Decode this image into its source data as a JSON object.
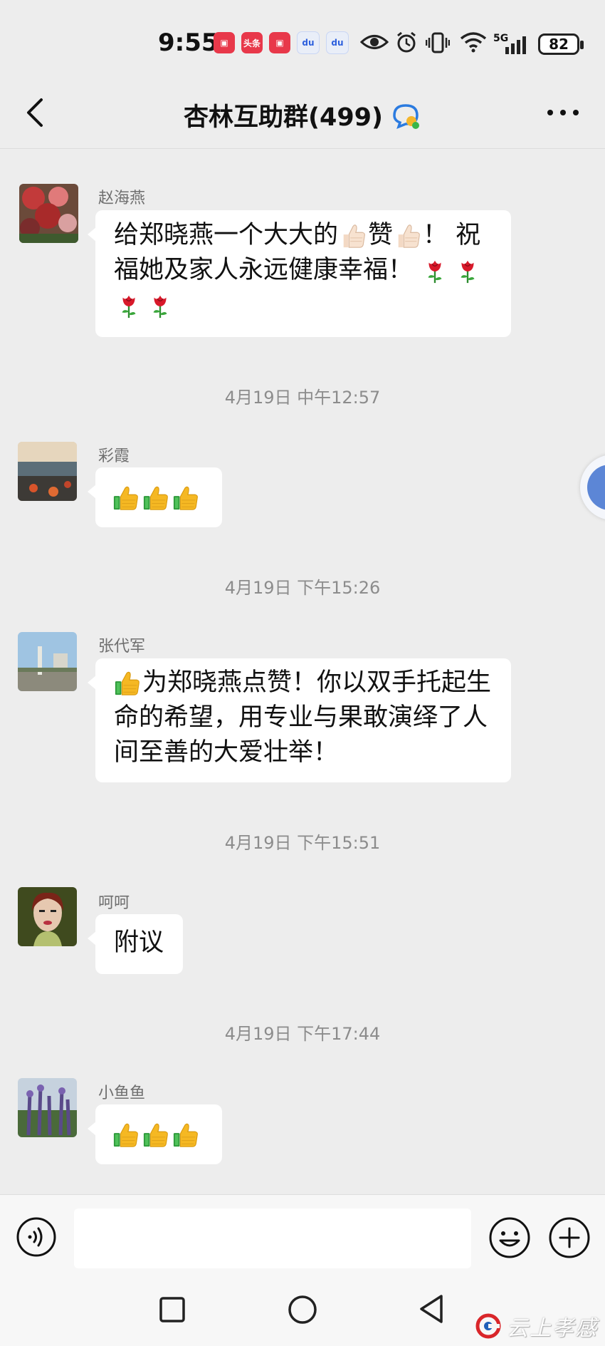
{
  "status_bar": {
    "time": "9:55",
    "app_icons": [
      "news-app-icon",
      "toutiao-icon",
      "news-app-icon",
      "baidu-icon",
      "baidu-icon"
    ],
    "toutiao_label": "头条",
    "network": "5G",
    "battery": "82"
  },
  "header": {
    "title": "杏林互助群(499)"
  },
  "messages": [
    {
      "sender": "赵海燕",
      "lines": [
        "给郑晓燕一个大大的👍🏻赞👍🏻！ 祝",
        "福她及家人永远健康幸福！ 🌹🌹",
        "🌹🌹"
      ],
      "line1_text_a": "给郑晓燕一个大大的",
      "line1_text_b": "赞",
      "line1_text_c": "！ 祝",
      "line2_text": "福她及家人永远健康幸福！"
    },
    {
      "timestamp": "4月19日 中午12:57",
      "sender": "彩霞",
      "emoji": [
        "thumbs-up",
        "thumbs-up",
        "thumbs-up"
      ]
    },
    {
      "timestamp": "4月19日 下午15:26",
      "sender": "张代军",
      "line1": "为郑晓燕点赞！你以双手托起生",
      "line2": "命的希望，用专业与果敢演绎了人",
      "line3": "间至善的大爱壮举！"
    },
    {
      "timestamp": "4月19日 下午15:51",
      "sender": "呵呵",
      "text": "附议"
    },
    {
      "timestamp": "4月19日 下午17:44",
      "sender": "小鱼鱼",
      "emoji": [
        "thumbs-up",
        "thumbs-up",
        "thumbs-up"
      ]
    }
  ],
  "input": {
    "value": "",
    "placeholder": ""
  },
  "watermark": {
    "text": "云上孝感"
  },
  "colors": {
    "background": "#ededed",
    "bubble": "#ffffff",
    "thumbs_yellow": "#f5b823",
    "thumbs_green": "#2e9b3b",
    "rose_red": "#d8192a"
  }
}
